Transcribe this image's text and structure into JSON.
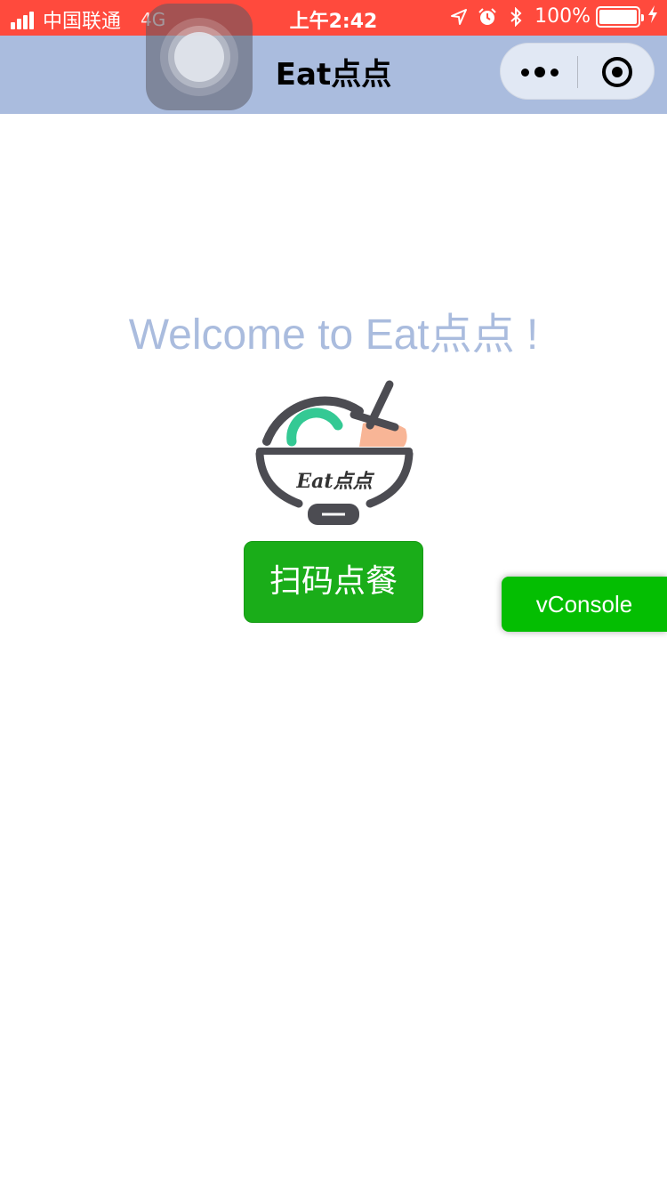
{
  "status_bar": {
    "carrier": "中国联通",
    "network": "4G",
    "time": "上午2:42",
    "battery_percent": "100%",
    "battery_level": 1.0,
    "icons": [
      "location-icon",
      "alarm-icon",
      "bluetooth-icon",
      "charging-icon"
    ]
  },
  "nav": {
    "title": "Eat点点",
    "capsule": [
      "more-icon",
      "close-mini-program-icon"
    ]
  },
  "main": {
    "welcome_text": "Welcome to Eat点点 !",
    "logo_text": "Eat点点",
    "scan_button_label": "扫码点餐"
  },
  "vconsole": {
    "label": "vConsole"
  },
  "colors": {
    "status_bar": "#ff4a3d",
    "nav_bar": "#aabcde",
    "welcome_text": "#aabcde",
    "primary_button": "#1aad19",
    "vconsole": "#04be02"
  }
}
